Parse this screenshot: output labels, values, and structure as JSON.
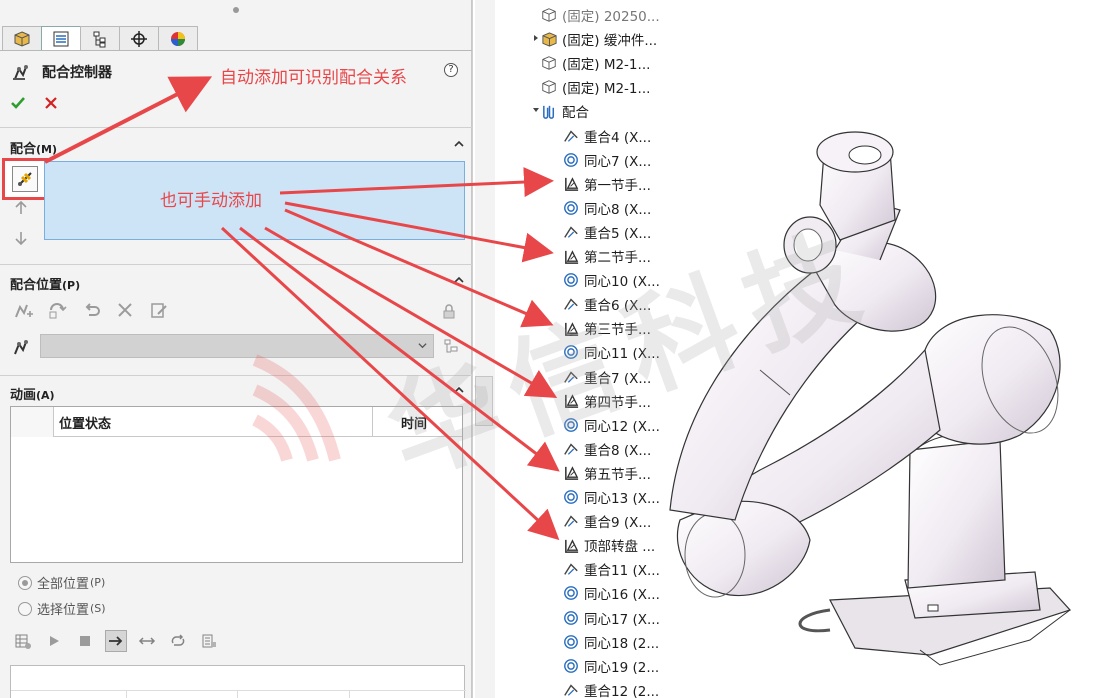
{
  "property_manager": {
    "tabs": [
      {
        "name": "feature-manager-tab",
        "icon": "cube-icon"
      },
      {
        "name": "property-manager-tab",
        "icon": "list-icon"
      },
      {
        "name": "configuration-manager-tab",
        "icon": "config-tree-icon"
      },
      {
        "name": "dimxpert-tab",
        "icon": "crosshair-icon"
      },
      {
        "name": "display-manager-tab",
        "icon": "color-wheel-icon"
      }
    ],
    "title": "配合控制器",
    "sections": {
      "mates": {
        "title": "配合",
        "hotkey": "(M)"
      },
      "mate_positions": {
        "title": "配合位置",
        "hotkey": "(P)"
      },
      "animation": {
        "title": "动画",
        "hotkey": "(A)"
      }
    },
    "animation_table": {
      "columns": [
        "位置状态",
        "时间"
      ]
    },
    "radio_options": [
      {
        "label": "全部位置",
        "hotkey": "(P)",
        "selected": true
      },
      {
        "label": "选择位置",
        "hotkey": "(S)",
        "selected": false
      }
    ]
  },
  "annotations": {
    "auto_add": "自动添加可识别配合关系",
    "manual_add": "也可手动添加",
    "help": "?"
  },
  "feature_tree": {
    "items": [
      {
        "label": "(固定) 20250...",
        "icon": "part-icon",
        "indent": 1,
        "faded": true
      },
      {
        "label": "(固定) 缓冲件...",
        "icon": "subassembly-icon",
        "indent": 1,
        "expandable": true
      },
      {
        "label": "(固定) M2-1...",
        "icon": "part-icon",
        "indent": 1
      },
      {
        "label": "(固定) M2-1...",
        "icon": "part-icon",
        "indent": 1
      },
      {
        "label": "配合",
        "icon": "mates-folder-icon",
        "indent": 1,
        "expanded": true
      },
      {
        "label": "重合4 (X...",
        "icon": "coincident-icon",
        "indent": 2
      },
      {
        "label": "同心7 (X...",
        "icon": "concentric-icon",
        "indent": 2
      },
      {
        "label": "第一节手...",
        "icon": "controller-mate-icon",
        "indent": 2
      },
      {
        "label": "同心8 (X...",
        "icon": "concentric-icon",
        "indent": 2
      },
      {
        "label": "重合5 (X...",
        "icon": "coincident-icon",
        "indent": 2
      },
      {
        "label": "第二节手...",
        "icon": "controller-mate-icon",
        "indent": 2
      },
      {
        "label": "同心10 (X...",
        "icon": "concentric-icon",
        "indent": 2
      },
      {
        "label": "重合6 (X...",
        "icon": "coincident-icon",
        "indent": 2
      },
      {
        "label": "第三节手...",
        "icon": "controller-mate-icon",
        "indent": 2
      },
      {
        "label": "同心11 (X...",
        "icon": "concentric-icon",
        "indent": 2
      },
      {
        "label": "重合7 (X...",
        "icon": "coincident-icon",
        "indent": 2
      },
      {
        "label": "第四节手...",
        "icon": "controller-mate-icon",
        "indent": 2
      },
      {
        "label": "同心12 (X...",
        "icon": "concentric-icon",
        "indent": 2
      },
      {
        "label": "重合8 (X...",
        "icon": "coincident-icon",
        "indent": 2
      },
      {
        "label": "第五节手...",
        "icon": "controller-mate-icon",
        "indent": 2
      },
      {
        "label": "同心13 (X...",
        "icon": "concentric-icon",
        "indent": 2
      },
      {
        "label": "重合9 (X...",
        "icon": "coincident-icon",
        "indent": 2
      },
      {
        "label": "顶部转盘 ...",
        "icon": "controller-mate-icon",
        "indent": 2
      },
      {
        "label": "重合11 (X...",
        "icon": "coincident-icon",
        "indent": 2
      },
      {
        "label": "同心16 (X...",
        "icon": "concentric-icon",
        "indent": 2
      },
      {
        "label": "同心17 (X...",
        "icon": "concentric-icon",
        "indent": 2
      },
      {
        "label": "同心18 (2...",
        "icon": "concentric-icon",
        "indent": 2
      },
      {
        "label": "同心19 (2...",
        "icon": "concentric-icon",
        "indent": 2
      },
      {
        "label": "重合12 (2...",
        "icon": "coincident-icon",
        "indent": 2
      }
    ]
  },
  "watermark": "华信科技",
  "colors": {
    "annotation_red": "#e8474a",
    "selection_blue": "#cde3f6",
    "ok_green": "#2e9e2e",
    "cancel_red": "#d42020"
  }
}
